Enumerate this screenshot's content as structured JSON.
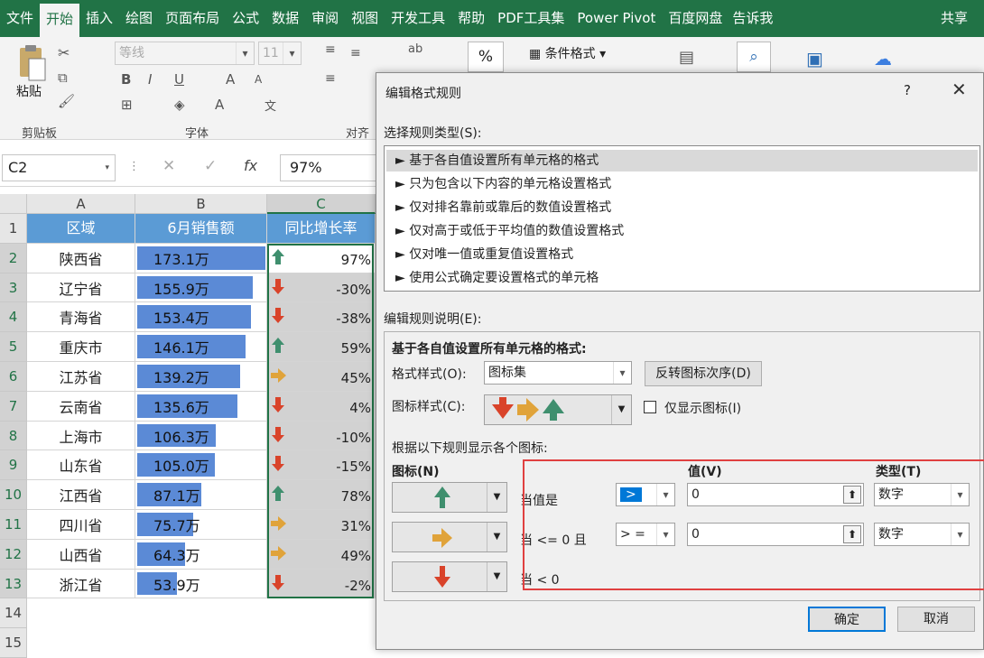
{
  "ribbon": {
    "tabs": [
      "文件",
      "开始",
      "插入",
      "绘图",
      "页面布局",
      "公式",
      "数据",
      "审阅",
      "视图",
      "开发工具",
      "帮助",
      "PDF工具集",
      "Power Pivot",
      "百度网盘",
      "告诉我"
    ],
    "share": "共享",
    "paste_label": "粘贴",
    "clipboard_label": "剪贴板",
    "font_label": "字体",
    "align_label": "对齐",
    "font_name": "等线",
    "font_size": "11",
    "percent": "%",
    "cond_format": "条件格式"
  },
  "formula_bar": {
    "name_box": "C2",
    "fx": "fx",
    "value": "97%"
  },
  "sheet": {
    "columns": [
      "A",
      "B",
      "C"
    ],
    "header_row": [
      "区域",
      "6月销售额",
      "同比增长率"
    ],
    "rows": [
      {
        "region": "陕西省",
        "sales": "173.1万",
        "sales_value": 173.1,
        "growth": "97%",
        "icon": "up"
      },
      {
        "region": "辽宁省",
        "sales": "155.9万",
        "sales_value": 155.9,
        "growth": "-30%",
        "icon": "down"
      },
      {
        "region": "青海省",
        "sales": "153.4万",
        "sales_value": 153.4,
        "growth": "-38%",
        "icon": "down"
      },
      {
        "region": "重庆市",
        "sales": "146.1万",
        "sales_value": 146.1,
        "growth": "59%",
        "icon": "up"
      },
      {
        "region": "江苏省",
        "sales": "139.2万",
        "sales_value": 139.2,
        "growth": "45%",
        "icon": "right"
      },
      {
        "region": "云南省",
        "sales": "135.6万",
        "sales_value": 135.6,
        "growth": "4%",
        "icon": "down"
      },
      {
        "region": "上海市",
        "sales": "106.3万",
        "sales_value": 106.3,
        "growth": "-10%",
        "icon": "down"
      },
      {
        "region": "山东省",
        "sales": "105.0万",
        "sales_value": 105.0,
        "growth": "-15%",
        "icon": "down"
      },
      {
        "region": "江西省",
        "sales": "87.1万",
        "sales_value": 87.1,
        "growth": "78%",
        "icon": "up"
      },
      {
        "region": "四川省",
        "sales": "75.7万",
        "sales_value": 75.7,
        "growth": "31%",
        "icon": "right"
      },
      {
        "region": "山西省",
        "sales": "64.3万",
        "sales_value": 64.3,
        "growth": "49%",
        "icon": "right"
      },
      {
        "region": "浙江省",
        "sales": "53.9万",
        "sales_value": 53.9,
        "growth": "-2%",
        "icon": "down"
      }
    ],
    "row_numbers": [
      "1",
      "2",
      "3",
      "4",
      "5",
      "6",
      "7",
      "8",
      "9",
      "10",
      "11",
      "12",
      "13",
      "14",
      "15"
    ]
  },
  "dialog": {
    "title": "编辑格式规则",
    "help": "?",
    "close": "✕",
    "select_rule_type": "选择规则类型(S):",
    "rule_types": [
      "► 基于各自值设置所有单元格的格式",
      "► 只为包含以下内容的单元格设置格式",
      "► 仅对排名靠前或靠后的数值设置格式",
      "► 仅对高于或低于平均值的数值设置格式",
      "► 仅对唯一值或重复值设置格式",
      "► 使用公式确定要设置格式的单元格"
    ],
    "edit_desc": "编辑规则说明(E):",
    "desc_heading": "基于各自值设置所有单元格的格式:",
    "format_style_label": "格式样式(O):",
    "format_style_value": "图标集",
    "reverse_button": "反转图标次序(D)",
    "icon_style_label": "图标样式(C):",
    "show_icon_only": "仅显示图标(I)",
    "rules_intro": "根据以下规则显示各个图标:",
    "col_icon": "图标(N)",
    "col_value": "值(V)",
    "col_type": "类型(T)",
    "rule1_label": "当值是",
    "rule1_op": ">",
    "rule1_value": "0",
    "rule1_type": "数字",
    "rule2_label": "当 <= 0 且",
    "rule2_op": "> =",
    "rule2_value": "0",
    "rule2_type": "数字",
    "rule3_label": "当 < 0",
    "ok": "确定",
    "cancel": "取消"
  },
  "colors": {
    "green": "#217346",
    "header_blue": "#5b9bd5",
    "bar_blue": "#5b8ad6",
    "up": "#3f8f6e",
    "down": "#d9432a",
    "right": "#e0a33a"
  }
}
